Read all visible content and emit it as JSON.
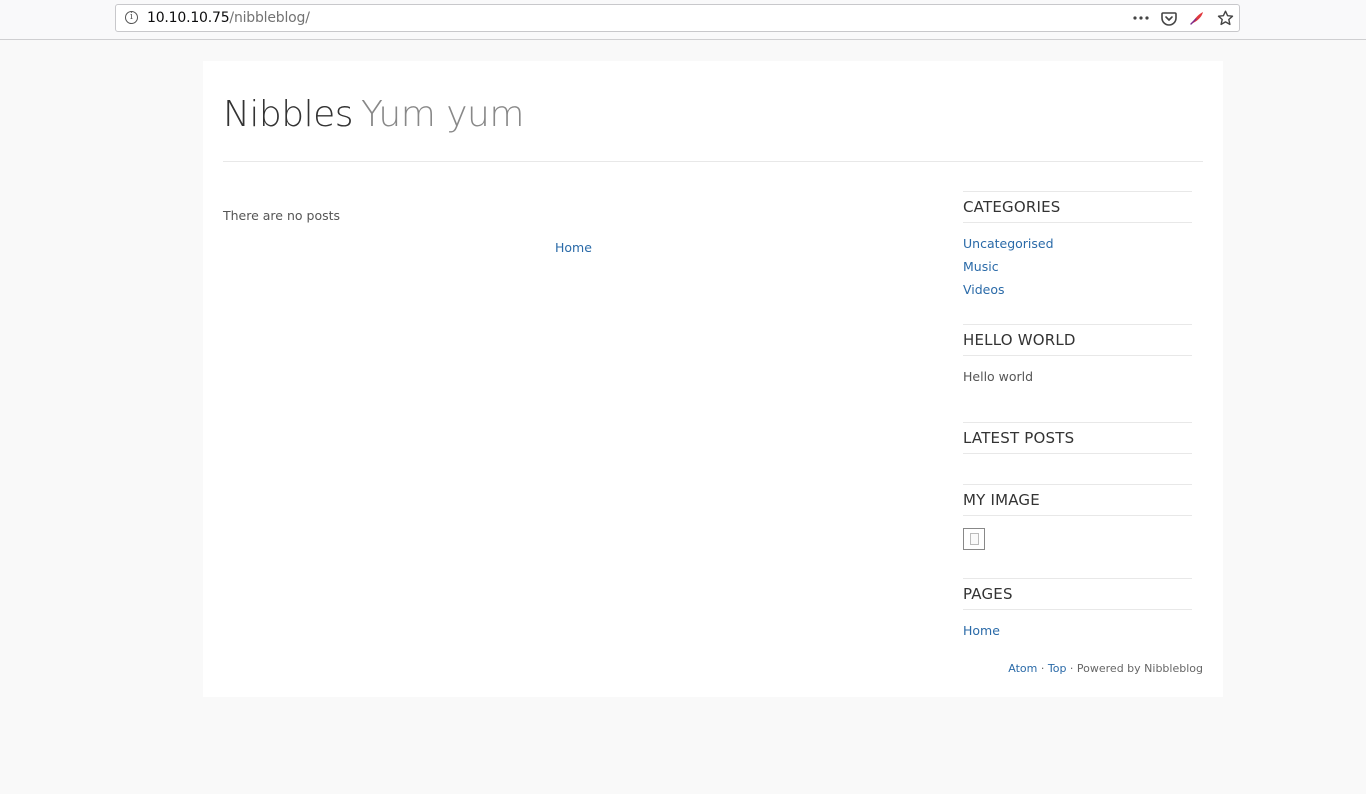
{
  "browser": {
    "url_host": "10.10.10.75",
    "url_path": "/nibbleblog/",
    "info_icon": "info-icon",
    "actions": [
      "more-actions-icon",
      "pocket-icon",
      "extension-feather-icon",
      "bookmark-star-icon"
    ],
    "accent_color": "#e0393e"
  },
  "header": {
    "title": "Nibbles",
    "slogan": "Yum yum"
  },
  "main": {
    "empty_message": "There are no posts",
    "pager_home": "Home"
  },
  "sidebar": {
    "categories": {
      "title": "CATEGORIES",
      "items": [
        "Uncategorised",
        "Music",
        "Videos"
      ]
    },
    "hello_world": {
      "title": "HELLO WORLD",
      "text": "Hello world"
    },
    "latest_posts": {
      "title": "LATEST POSTS"
    },
    "my_image": {
      "title": "MY IMAGE",
      "icon": "broken-image-icon"
    },
    "pages": {
      "title": "PAGES",
      "items": [
        "Home"
      ]
    }
  },
  "footer": {
    "atom": "Atom",
    "sep1": " · ",
    "top": "Top",
    "powered": " · Powered by Nibbleblog"
  },
  "colors": {
    "link": "#2a6aa8",
    "text": "#333333",
    "muted": "#888888",
    "background": "#f9f9f9"
  }
}
